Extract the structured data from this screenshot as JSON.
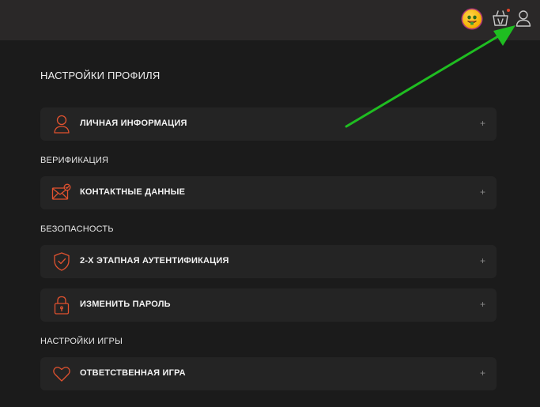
{
  "header": {
    "avatar_icon": "money-mouth-emoji-icon",
    "gift_icon": "gift-basket-icon",
    "user_icon": "user-icon",
    "notification_color": "#e2452a"
  },
  "page": {
    "title": "НАСТРОЙКИ ПРОФИЛЯ"
  },
  "sections": {
    "verification": "ВЕРИФИКАЦИЯ",
    "security": "БЕЗОПАСНОСТЬ",
    "game_settings": "НАСТРОЙКИ ИГРЫ"
  },
  "cards": {
    "personal_info": {
      "label": "ЛИЧНАЯ ИНФОРМАЦИЯ",
      "icon": "user-outline-icon",
      "toggle": "+"
    },
    "contact_data": {
      "label": "КОНТАКТНЫЕ ДАННЫЕ",
      "icon": "envelope-check-icon",
      "toggle": "+"
    },
    "two_factor": {
      "label": "2-Х ЭТАПНАЯ АУТЕНТИФИКАЦИЯ",
      "icon": "shield-check-icon",
      "toggle": "+"
    },
    "change_password": {
      "label": "ИЗМЕНИТЬ ПАРОЛЬ",
      "icon": "padlock-icon",
      "toggle": "+"
    },
    "responsible_gaming": {
      "label": "ОТВЕТСТВЕННАЯ ИГРА",
      "icon": "heart-icon",
      "toggle": "+"
    }
  },
  "colors": {
    "accent": "#e0522f",
    "annotation_arrow": "#1fbd21",
    "background": "#1b1b1b",
    "card": "#242424",
    "topbar": "#2a2828"
  }
}
